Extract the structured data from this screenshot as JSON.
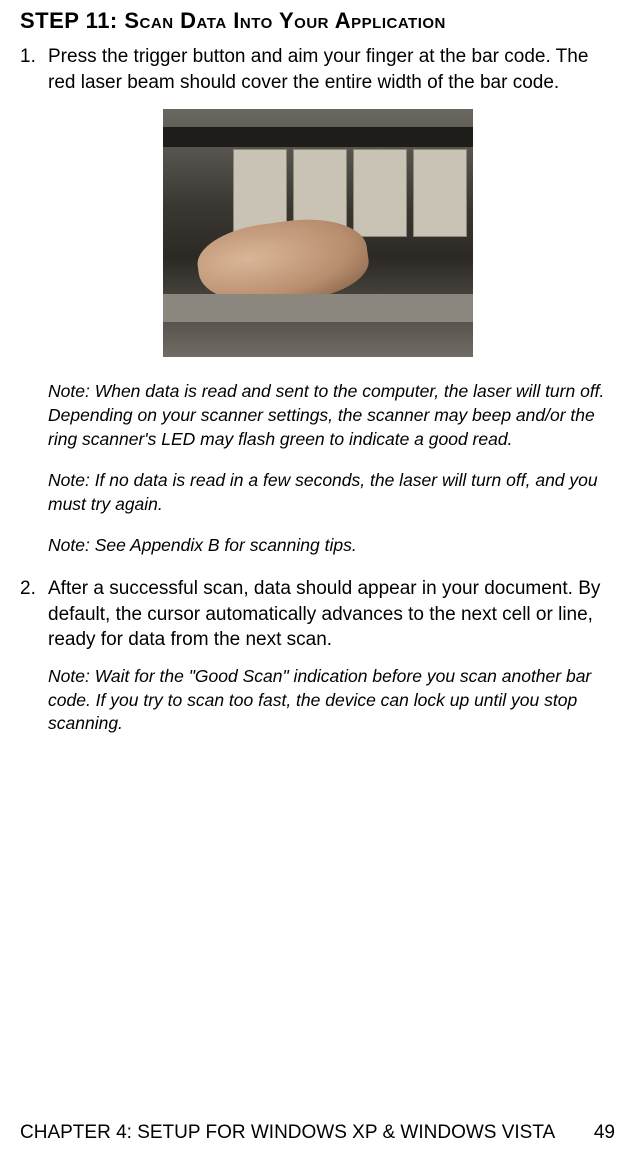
{
  "heading": {
    "prefix": "STEP 11: ",
    "rest": "Scan Data Into Your Application"
  },
  "item1": {
    "num": "1.",
    "text": "Press the trigger button and aim your finger at the bar code. The red laser beam should cover the entire width of the bar code."
  },
  "note1": "Note: When data is read and sent to the computer, the laser will turn off. Depending on your scanner settings, the scanner may beep and/or the ring scanner's LED may flash green to indicate a good read.",
  "note2": "Note: If no data is read in a few seconds, the laser will turn off, and you must try again.",
  "note3": "Note: See Appendix B for scanning tips.",
  "item2": {
    "num": "2.",
    "text": "After a successful scan, data should appear in your document. By default, the cursor automatically advances to the next cell or line, ready for data from the next scan."
  },
  "note4": "Note: Wait for the \"Good Scan\" indication before you scan another bar code. If you try to scan too fast, the device can lock up until you stop scanning.",
  "footer": {
    "chapter": "CHAPTER 4: SETUP FOR WINDOWS XP & WINDOWS VISTA",
    "page": "49"
  }
}
